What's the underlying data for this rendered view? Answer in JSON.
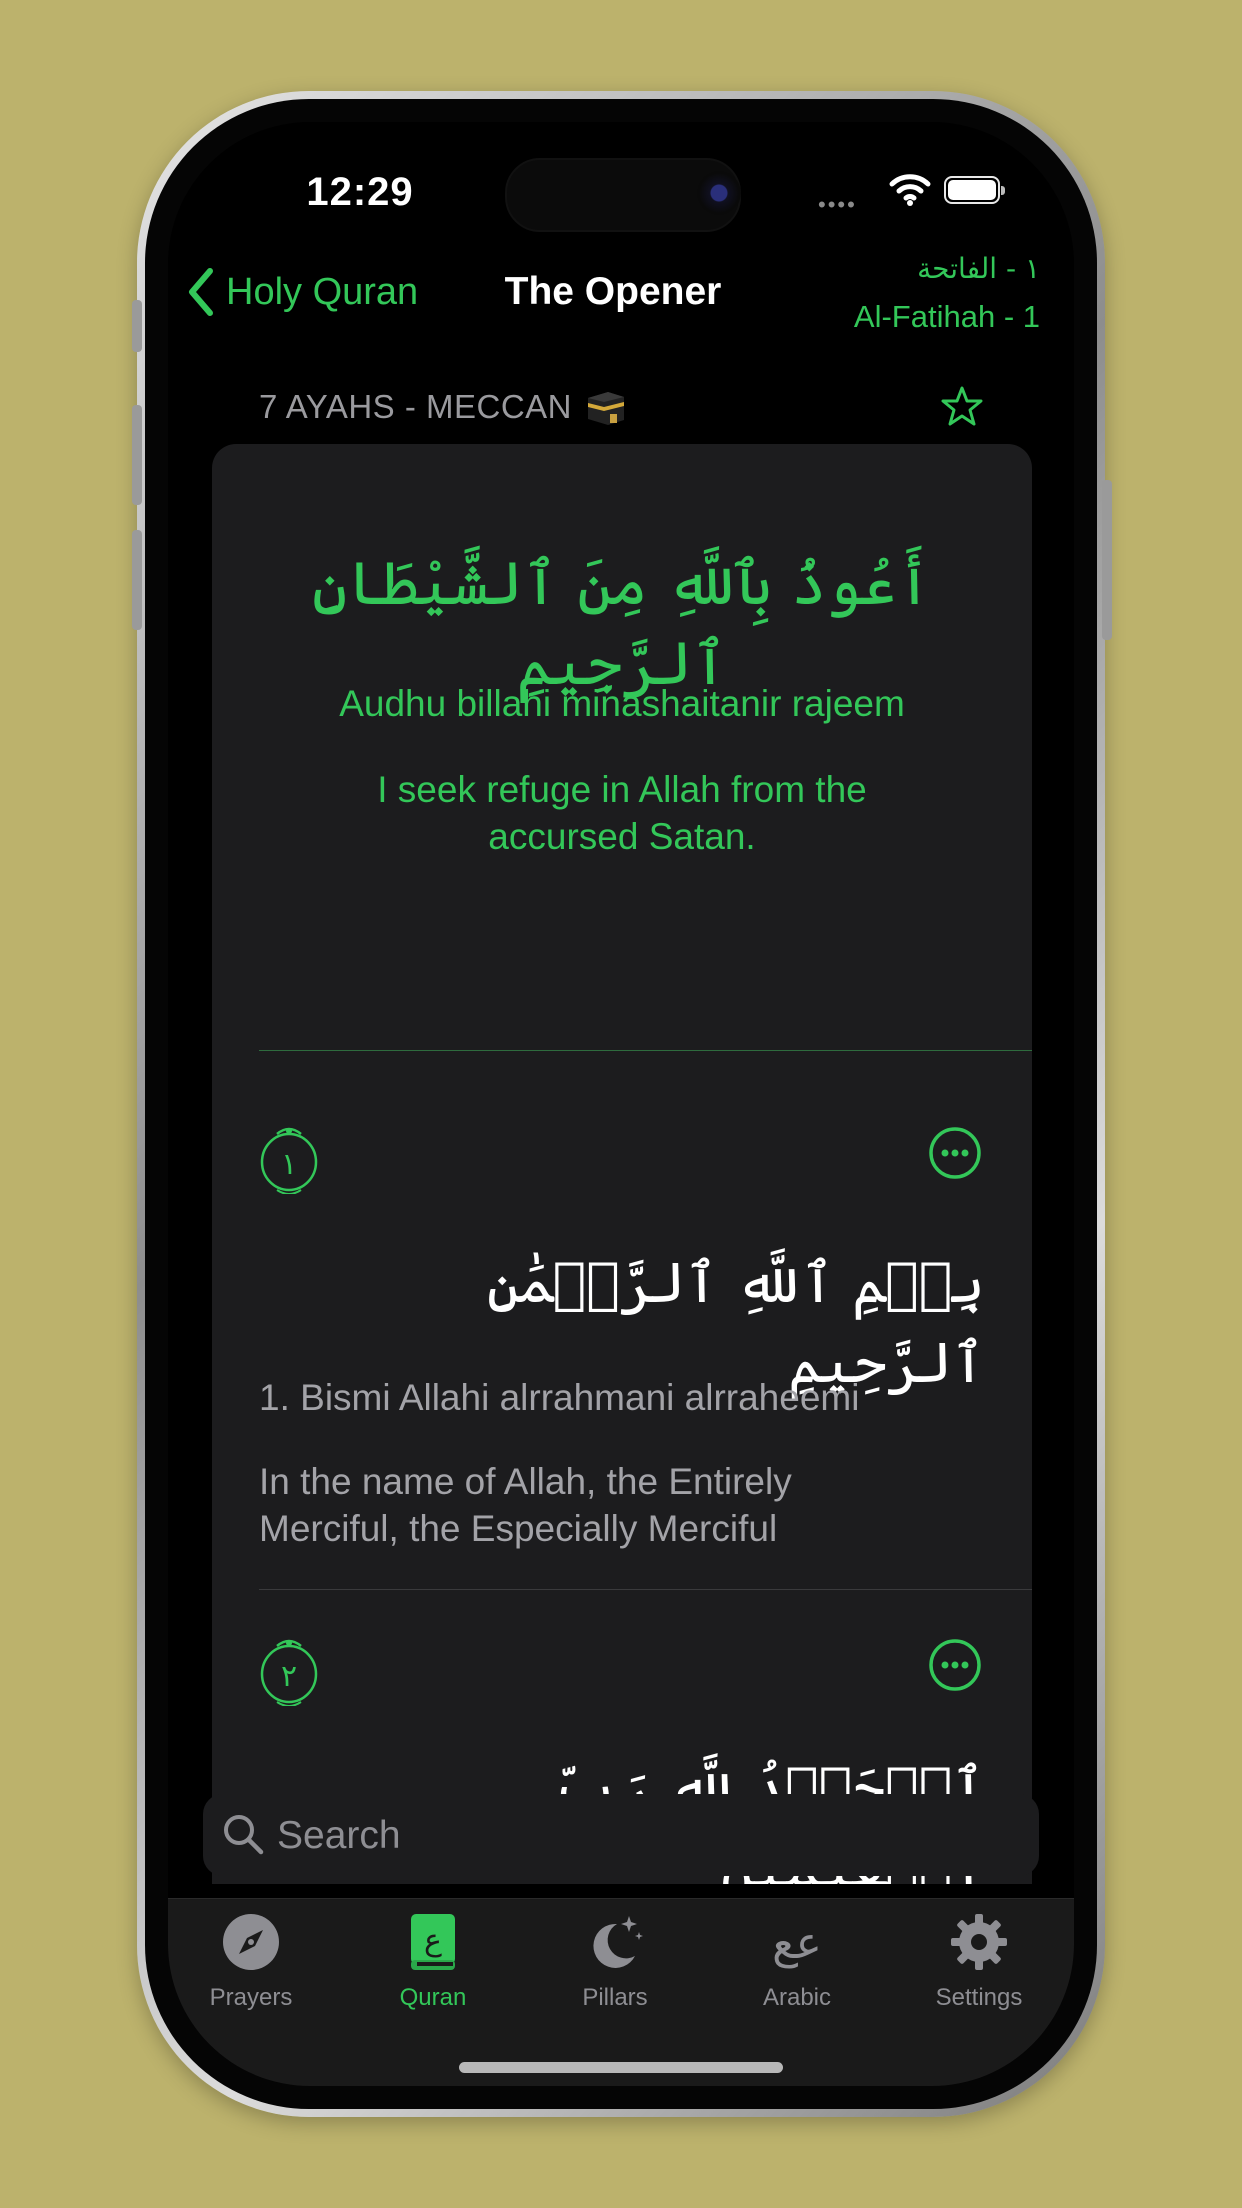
{
  "status_bar": {
    "time": "12:29"
  },
  "nav": {
    "back_label": "Holy Quran",
    "title": "The Opener",
    "surah_arabic": "١ - الفاتحة",
    "surah_english": "Al-Fatihah - 1"
  },
  "section": {
    "header": "7 AYAHS - MECCAN"
  },
  "istiadhah": {
    "arabic": "أَعُوذُ بِٱللَّهِ مِنَ ٱلشَّيْطَانِ ٱلرَّجِيمِ",
    "transliteration": "Audhu billahi minashaitanir rajeem",
    "translation": "I seek refuge in Allah from the accursed Satan."
  },
  "ayahs": [
    {
      "number_arabic": "١",
      "arabic": "بِسۡمِ ٱللَّهِ ٱلرَّحۡمَٰنِ ٱلرَّحِيمِ",
      "transliteration": "1. Bismi Allahi alrrahmani alrraheemi",
      "translation": "In the name of Allah, the Entirely Merciful, the Especially Merciful"
    },
    {
      "number_arabic": "٢",
      "arabic": "ٱلۡحَمۡدُ لِلَّهِ رَبِّ ٱلۡعَٰلَمِينَ"
    }
  ],
  "search": {
    "placeholder": "Search"
  },
  "tabs": [
    {
      "label": "Prayers",
      "icon": "compass-icon"
    },
    {
      "label": "Quran",
      "icon": "quran-book-icon"
    },
    {
      "label": "Pillars",
      "icon": "moon-stars-icon"
    },
    {
      "label": "Arabic",
      "icon": "arabic-letters-icon"
    },
    {
      "label": "Settings",
      "icon": "gear-icon"
    }
  ],
  "colors": {
    "accent": "#33c759",
    "background": "#000000",
    "card": "#1c1c1e",
    "secondary_text": "#a3a3a8",
    "page_backdrop": "#bcb26c"
  }
}
